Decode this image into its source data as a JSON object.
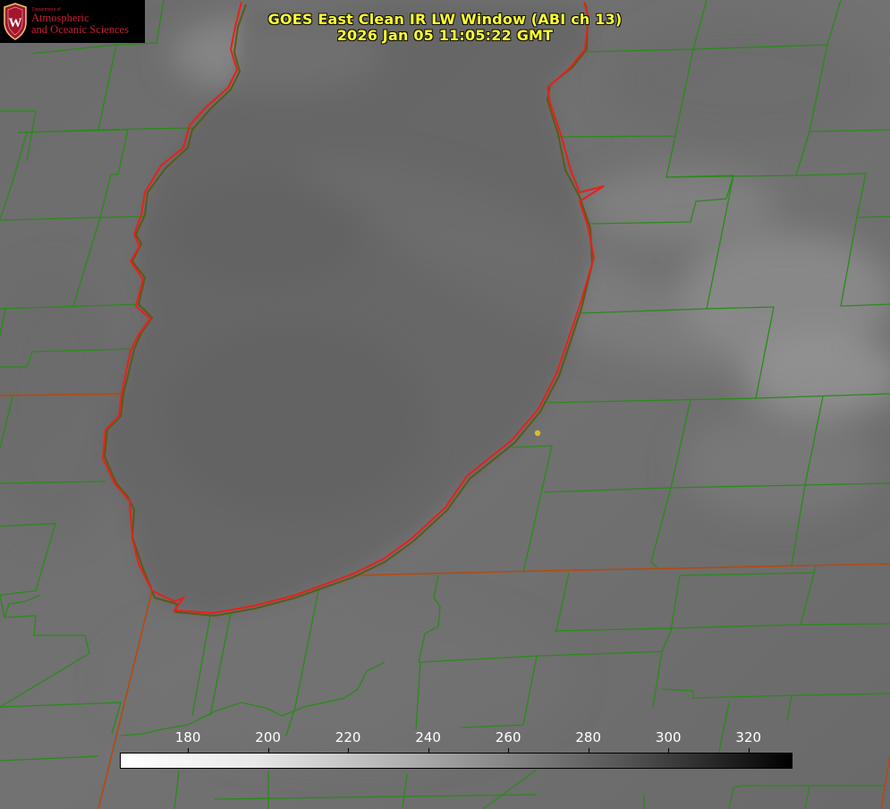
{
  "header": {
    "title_line_1": "GOES East Clean IR LW Window (ABI ch 13)",
    "title_line_2": "2026 Jan 05 11:05:22 GMT"
  },
  "logo": {
    "department_label": "Department of",
    "name_line_1": "Atmospheric",
    "name_line_2": "and Oceanic Sciences",
    "crest_letter": "W",
    "text_color": "#c0203a",
    "crest_color": "#a3162e"
  },
  "map": {
    "county_border_color": "#2a8a1a",
    "state_border_color": "#b34a10",
    "lake_outline_color": "#e8201a",
    "marker_color": "#d9c21a"
  },
  "colorbar": {
    "tick_labels": [
      "180",
      "200",
      "220",
      "240",
      "260",
      "280",
      "300",
      "320"
    ],
    "tick_values": [
      180,
      200,
      220,
      240,
      260,
      280,
      300,
      320
    ],
    "range": [
      163,
      331
    ],
    "gradient": "white-to-black"
  }
}
